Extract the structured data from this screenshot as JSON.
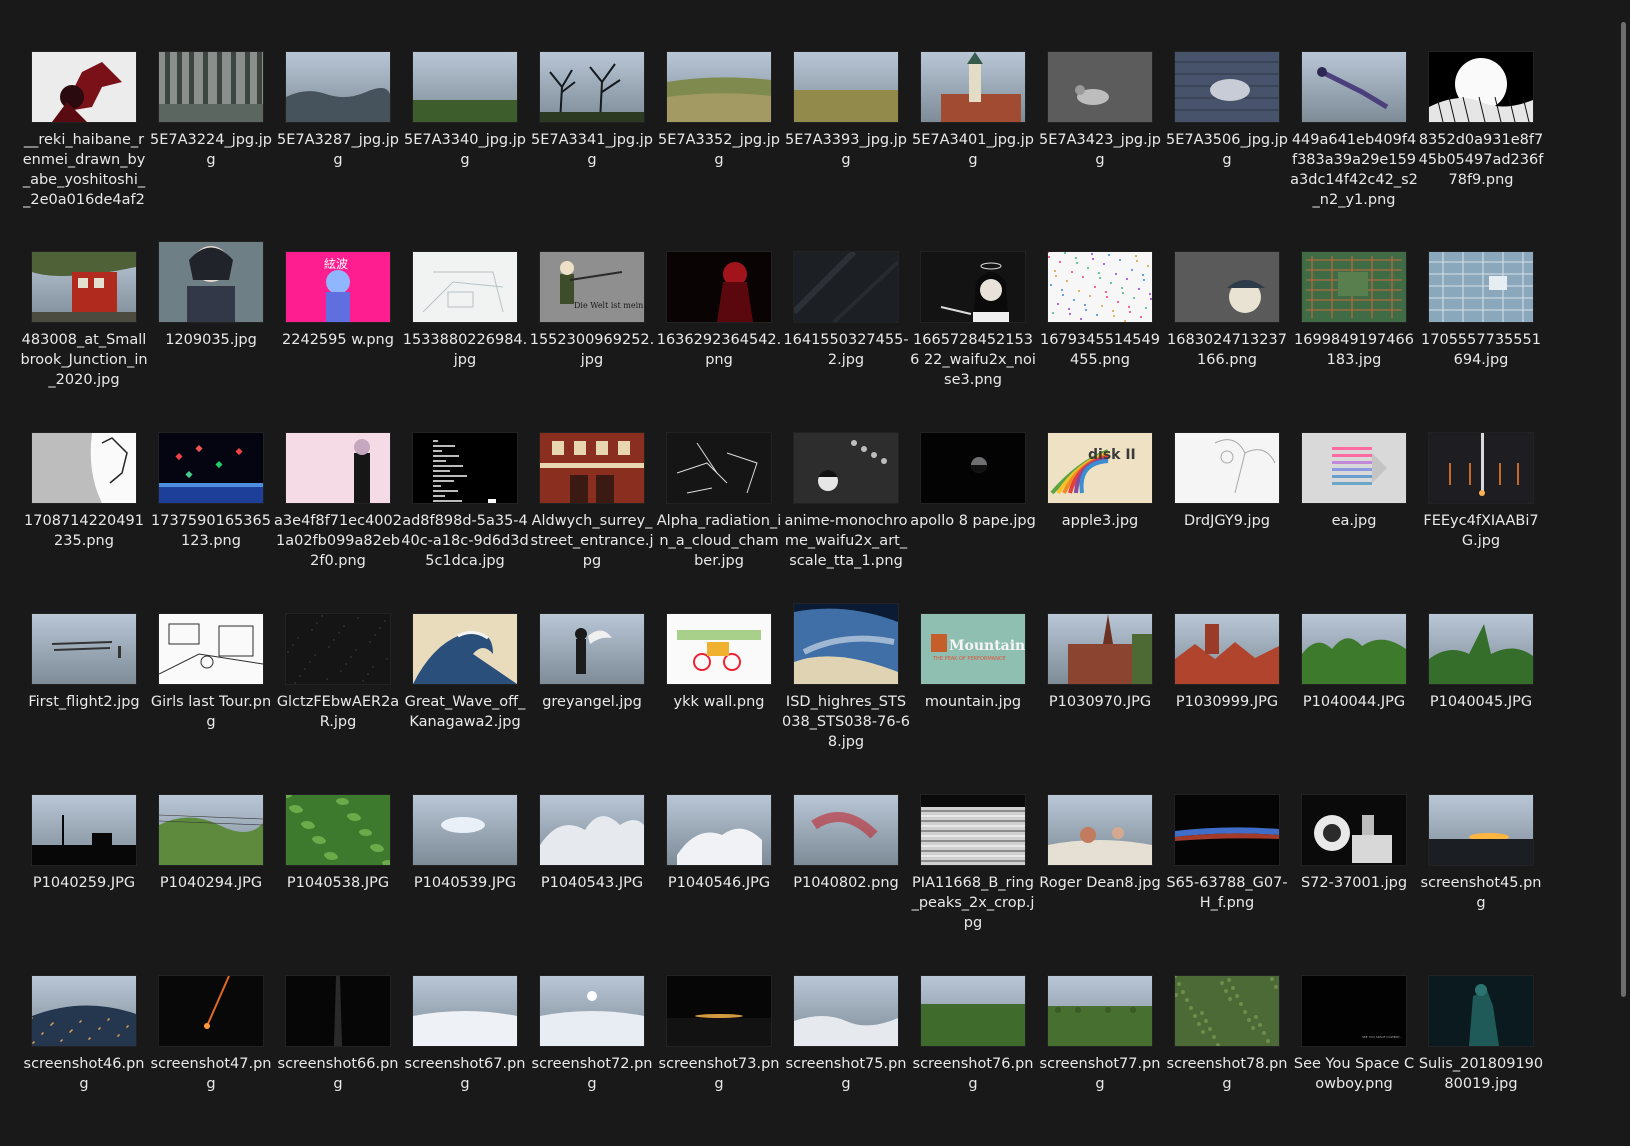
{
  "colors": {
    "background": "#191919",
    "label_text": "#e9e9e9",
    "scrollbar_thumb": "#6d6d6d"
  },
  "files": [
    {
      "name": "__reki_haibane_renmei_drawn_by_abe_yoshitoshi__2e0a016de4af27…",
      "thumb": "anime-red-wings",
      "aspect": "wide"
    },
    {
      "name": "5E7A3224_jpg.jpg",
      "thumb": "forest-trees",
      "aspect": "wide"
    },
    {
      "name": "5E7A3287_jpg.jpg",
      "thumb": "misty-forest",
      "aspect": "wide"
    },
    {
      "name": "5E7A3340_jpg.jpg",
      "thumb": "blue-sky-field",
      "aspect": "wide"
    },
    {
      "name": "5E7A3341_jpg.jpg",
      "thumb": "bare-trees-sky",
      "aspect": "wide"
    },
    {
      "name": "5E7A3352_jpg.jpg",
      "thumb": "hill-landscape",
      "aspect": "wide"
    },
    {
      "name": "5E7A3393_jpg.jpg",
      "thumb": "flat-field",
      "aspect": "wide"
    },
    {
      "name": "5E7A3401_jpg.jpg",
      "thumb": "church-tower",
      "aspect": "wide"
    },
    {
      "name": "5E7A3423_jpg.jpg",
      "thumb": "pigeon-ground",
      "aspect": "wide"
    },
    {
      "name": "5E7A3506_jpg.jpg",
      "thumb": "pigeon-cobble",
      "aspect": "wide"
    },
    {
      "name": "449a641eb409f4f383a39a29e159a3dc14f42c42_s2_n2_y1.png",
      "thumb": "girl-underwater",
      "aspect": "wide"
    },
    {
      "name": "8352d0a931e8f745b05497ad236f78f9.png",
      "thumb": "moon-sketch",
      "aspect": "wide"
    },
    {
      "name": "483008_at_Smallbrook_Junction_in_2020.jpg",
      "thumb": "red-train",
      "aspect": "wide"
    },
    {
      "name": "1209035.jpg",
      "thumb": "anime-portrait",
      "aspect": "tall"
    },
    {
      "name": "2242595 w.png",
      "thumb": "pink-anime",
      "aspect": "wide"
    },
    {
      "name": "1533880226984.jpg",
      "thumb": "sketch-room",
      "aspect": "wide"
    },
    {
      "name": "1552300969252.jpg",
      "thumb": "soldier-grey",
      "aspect": "wide"
    },
    {
      "name": "1636292364542.png",
      "thumb": "dark-red-figure",
      "aspect": "wide"
    },
    {
      "name": "1641550327455-2.jpg",
      "thumb": "dark-texture",
      "aspect": "wide"
    },
    {
      "name": "16657284521536 22_waifu2x_noise3.png",
      "thumb": "smoking-girl",
      "aspect": "wide"
    },
    {
      "name": "1679345514549455.png",
      "thumb": "white-speckle",
      "aspect": "wide"
    },
    {
      "name": "1683024713237166.png",
      "thumb": "grey-cap-girl",
      "aspect": "wide"
    },
    {
      "name": "1699849197466183.jpg",
      "thumb": "circuit-green",
      "aspect": "wide"
    },
    {
      "name": "1705557735551694.jpg",
      "thumb": "circuit-blue",
      "aspect": "wide"
    },
    {
      "name": "1708714220491235.png",
      "thumb": "manga-face",
      "aspect": "wide"
    },
    {
      "name": "1737590165365123.png",
      "thumb": "space-gems",
      "aspect": "wide"
    },
    {
      "name": "a3e4f8f71ec40021a02fb099a82eb2f0.png",
      "thumb": "pink-girl",
      "aspect": "wide"
    },
    {
      "name": "ad8f898d-5a35-440c-a18c-9d6d3d5c1dca.jpg",
      "thumb": "black-waveform",
      "aspect": "wide"
    },
    {
      "name": "Aldwych_surrey_street_entrance.jpg",
      "thumb": "station-building",
      "aspect": "wide"
    },
    {
      "name": "Alpha_radiation_in_a_cloud_chamber.jpg",
      "thumb": "cloud-chamber",
      "aspect": "wide"
    },
    {
      "name": "anime-monochrome_waifu2x_art_scale_tta_1.png",
      "thumb": "mono-anime",
      "aspect": "wide"
    },
    {
      "name": "apollo 8 pape.jpg",
      "thumb": "earthrise",
      "aspect": "wide"
    },
    {
      "name": "apple3.jpg",
      "thumb": "apple-disk",
      "aspect": "wide"
    },
    {
      "name": "DrdJGY9.jpg",
      "thumb": "angel-sketch",
      "aspect": "wide"
    },
    {
      "name": "ea.jpg",
      "thumb": "stripes-logo",
      "aspect": "wide"
    },
    {
      "name": "FEEyc4fXIAABi7G.jpg",
      "thumb": "rocket-launch",
      "aspect": "wide"
    },
    {
      "name": "First_flight2.jpg",
      "thumb": "first-flight",
      "aspect": "wide"
    },
    {
      "name": "Girls last Tour.png",
      "thumb": "manga-city",
      "aspect": "wide"
    },
    {
      "name": "GlctzFEbwAER2aR.jpg",
      "thumb": "dark-stars",
      "aspect": "wide"
    },
    {
      "name": "Great_Wave_off_Kanagawa2.jpg",
      "thumb": "great-wave",
      "aspect": "wide"
    },
    {
      "name": "greyangel.jpg",
      "thumb": "grey-angel",
      "aspect": "wide"
    },
    {
      "name": "ykk wall.png",
      "thumb": "ykk-bikes",
      "aspect": "wide"
    },
    {
      "name": "ISD_highres_STS038_STS038-76-68.jpg",
      "thumb": "earth-orbit",
      "aspect": "tall"
    },
    {
      "name": "mountain.jpg",
      "thumb": "mountain-logo",
      "aspect": "wide"
    },
    {
      "name": "P1030970.JPG",
      "thumb": "brick-church",
      "aspect": "wide"
    },
    {
      "name": "P1030999.JPG",
      "thumb": "town-roofs",
      "aspect": "wide"
    },
    {
      "name": "P1040044.JPG",
      "thumb": "green-trees-sky",
      "aspect": "wide"
    },
    {
      "name": "P1040045.JPG",
      "thumb": "fir-trees-sky",
      "aspect": "wide"
    },
    {
      "name": "P1040259.JPG",
      "thumb": "sunset-silhouette",
      "aspect": "wide"
    },
    {
      "name": "P1040294.JPG",
      "thumb": "power-lines-trees",
      "aspect": "wide"
    },
    {
      "name": "P1040538.JPG",
      "thumb": "green-leaves",
      "aspect": "wide"
    },
    {
      "name": "P1040539.JPG",
      "thumb": "blue-sky-cloud",
      "aspect": "wide"
    },
    {
      "name": "P1040543.JPG",
      "thumb": "big-clouds",
      "aspect": "wide"
    },
    {
      "name": "P1040546.JPG",
      "thumb": "white-clouds",
      "aspect": "wide"
    },
    {
      "name": "P1040802.png",
      "thumb": "red-night-sky",
      "aspect": "wide"
    },
    {
      "name": "PIA11668_B_ring_peaks_2x_crop.jpg",
      "thumb": "ring-peaks",
      "aspect": "wide"
    },
    {
      "name": "Roger Dean8.jpg",
      "thumb": "roger-dean",
      "aspect": "wide"
    },
    {
      "name": "S65-63788_G07-H_f.png",
      "thumb": "earth-horizon-thin",
      "aspect": "wide"
    },
    {
      "name": "S72-37001.jpg",
      "thumb": "astronaut",
      "aspect": "wide"
    },
    {
      "name": "screenshot45.png",
      "thumb": "sunrise-horizon",
      "aspect": "wide"
    },
    {
      "name": "screenshot46.png",
      "thumb": "earth-night-lights",
      "aspect": "wide"
    },
    {
      "name": "screenshot47.png",
      "thumb": "meteor-dark",
      "aspect": "wide"
    },
    {
      "name": "screenshot66.png",
      "thumb": "dark-beam",
      "aspect": "wide"
    },
    {
      "name": "screenshot67.png",
      "thumb": "above-clouds",
      "aspect": "wide"
    },
    {
      "name": "screenshot72.png",
      "thumb": "sun-over-clouds",
      "aspect": "wide"
    },
    {
      "name": "screenshot73.png",
      "thumb": "dark-sunrise",
      "aspect": "wide"
    },
    {
      "name": "screenshot75.png",
      "thumb": "overcast-clouds",
      "aspect": "wide"
    },
    {
      "name": "screenshot76.png",
      "thumb": "green-plain",
      "aspect": "wide"
    },
    {
      "name": "screenshot77.png",
      "thumb": "green-plain-2",
      "aspect": "wide"
    },
    {
      "name": "screenshot78.png",
      "thumb": "green-aerial",
      "aspect": "wide"
    },
    {
      "name": "See You Space Cowboy.png",
      "thumb": "black-credits",
      "aspect": "wide"
    },
    {
      "name": "Sulis_20180919080019.jpg",
      "thumb": "dark-teal-statue",
      "aspect": "wide"
    }
  ]
}
